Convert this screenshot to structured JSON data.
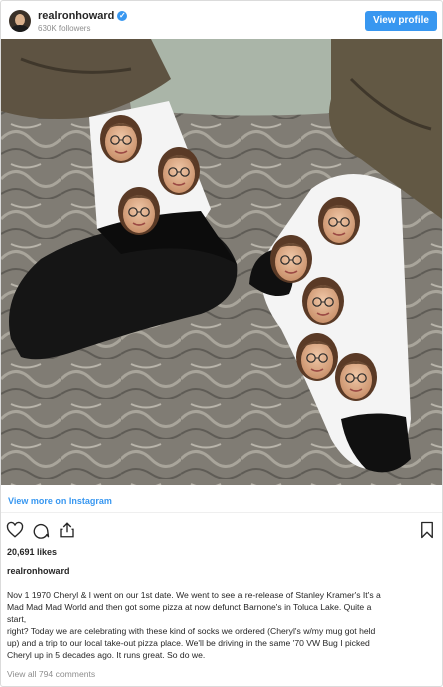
{
  "header": {
    "username": "realronhoward",
    "verified_icon": "verified-badge-icon",
    "verified_glyph": "✓",
    "followers": "630K followers",
    "view_profile_label": "View profile",
    "accent_color": "#3897f0"
  },
  "post": {
    "view_more_label": "View more on Instagram",
    "likes": "20,691 likes",
    "caption_username": "realronhoward",
    "caption_lines": [
      "Nov 1 1970 Cheryl & I went on our 1st date. We went to see a re-release of Stanley Kramer's It's a",
      "Mad Mad Mad World and then got some pizza at now defunct Barnone's in Toluca Lake. Quite a",
      "start,",
      "right? Today we are celebrating with these kind of socks we ordered (Cheryl's w/my mug got held",
      "up) and a trip to our local take-out pizza place. We'll be driving in the same '70 VW Bug I picked",
      "Cheryl up in 5 decades ago. It runs great. So do we."
    ],
    "view_all_comments": "View all 794 comments"
  },
  "icons": {
    "like": "heart-icon",
    "comment": "comment-icon",
    "share": "share-icon",
    "save": "bookmark-icon"
  }
}
